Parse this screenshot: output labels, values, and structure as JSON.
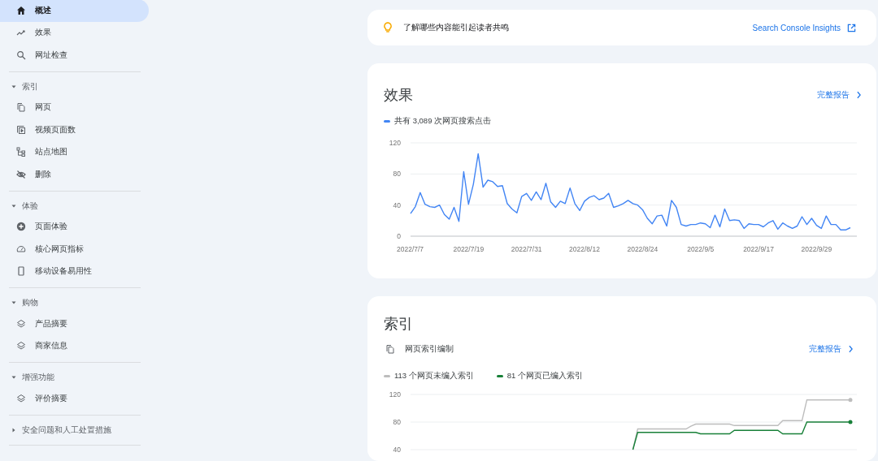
{
  "sidebar": {
    "items": [
      {
        "label": "概述",
        "selected": true
      },
      {
        "label": "效果",
        "selected": false
      },
      {
        "label": "网址检查",
        "selected": false
      }
    ],
    "groups": [
      {
        "title": "索引",
        "expanded": true,
        "items": [
          {
            "label": "网页",
            "selected": false
          },
          {
            "label": "视频页面数",
            "selected": false
          },
          {
            "label": "站点地图",
            "selected": false
          },
          {
            "label": "删除",
            "selected": false
          }
        ]
      },
      {
        "title": "体验",
        "expanded": true,
        "items": [
          {
            "label": "页面体验",
            "selected": false
          },
          {
            "label": "核心网页指标",
            "selected": false
          },
          {
            "label": "移动设备易用性",
            "selected": false
          }
        ]
      },
      {
        "title": "购物",
        "expanded": true,
        "items": [
          {
            "label": "产品摘要",
            "selected": false
          },
          {
            "label": "商家信息",
            "selected": false
          }
        ]
      },
      {
        "title": "增强功能",
        "expanded": true,
        "items": [
          {
            "label": "评价摘要",
            "selected": false
          }
        ]
      },
      {
        "title": "安全问题和人工处置措施",
        "expanded": false
      }
    ]
  },
  "insight": {
    "text": "了解哪些内容能引起读者共鸣",
    "link": "Search Console Insights"
  },
  "performance": {
    "title": "效果",
    "link": "完整报告",
    "chart_data": {
      "type": "line",
      "ylim": [
        0,
        120
      ],
      "yticks": [
        0,
        40,
        80,
        120
      ],
      "categories": [
        "2022/7/7",
        null,
        null,
        null,
        null,
        null,
        null,
        null,
        null,
        null,
        null,
        null,
        "2022/7/19",
        null,
        null,
        null,
        null,
        null,
        null,
        null,
        null,
        null,
        null,
        null,
        "2022/7/31",
        null,
        null,
        null,
        null,
        null,
        null,
        null,
        null,
        null,
        null,
        null,
        "2022/8/12",
        null,
        null,
        null,
        null,
        null,
        null,
        null,
        null,
        null,
        null,
        null,
        "2022/8/24",
        null,
        null,
        null,
        null,
        null,
        null,
        null,
        null,
        null,
        null,
        null,
        "2022/9/5",
        null,
        null,
        null,
        null,
        null,
        null,
        null,
        null,
        null,
        null,
        null,
        "2022/9/17",
        null,
        null,
        null,
        null,
        null,
        null,
        null,
        null,
        null,
        null,
        null,
        "2022/9/29",
        null,
        null,
        null,
        null,
        null,
        null,
        null
      ],
      "series": [
        {
          "name": "共有 3,089 次网页搜索点击",
          "color": "#4285f4",
          "values": [
            29,
            38,
            56,
            41,
            38,
            37,
            40,
            28,
            22,
            37,
            19,
            83,
            41,
            67,
            106,
            63,
            72,
            70,
            64,
            65,
            42,
            35,
            30,
            51,
            55,
            46,
            57,
            47,
            68,
            44,
            37,
            45,
            42,
            62,
            42,
            33,
            45,
            50,
            52,
            47,
            49,
            55,
            37,
            39,
            42,
            46,
            42,
            40,
            34,
            23,
            16,
            26,
            27,
            13,
            46,
            37,
            15,
            13,
            15,
            15,
            17,
            16,
            11,
            27,
            12,
            35,
            20,
            21,
            20,
            10,
            16,
            15,
            15,
            12,
            17,
            20,
            9,
            17,
            13,
            10,
            13,
            25,
            15,
            23,
            14,
            10,
            26,
            15,
            15,
            8,
            8,
            11
          ]
        }
      ]
    }
  },
  "index": {
    "title": "索引",
    "subtitle": "网页索引编制",
    "link": "完整报告",
    "chart_data": {
      "type": "line",
      "ylim": [
        40,
        120
      ],
      "yticks": [
        40,
        80,
        120
      ],
      "series": [
        {
          "name": "113 个网页未编入索引",
          "color": "#bdbdbd",
          "values": [
            null,
            null,
            null,
            null,
            null,
            null,
            null,
            null,
            null,
            null,
            null,
            null,
            null,
            null,
            null,
            null,
            null,
            null,
            null,
            null,
            null,
            null,
            null,
            null,
            null,
            null,
            null,
            null,
            null,
            null,
            null,
            null,
            null,
            null,
            null,
            null,
            null,
            null,
            null,
            null,
            null,
            null,
            null,
            null,
            null,
            null,
            40,
            70,
            70,
            70,
            70,
            70,
            70,
            70,
            70,
            70,
            70,
            70,
            74,
            77,
            77,
            77,
            77,
            77,
            77,
            77,
            77,
            75,
            75,
            75,
            75,
            75,
            75,
            75,
            75,
            75,
            75,
            82,
            82,
            82,
            82,
            82,
            112,
            112,
            112,
            112,
            112,
            112,
            112,
            112,
            112,
            112
          ]
        },
        {
          "name": "81 个网页已编入索引",
          "color": "#188038",
          "values": [
            null,
            null,
            null,
            null,
            null,
            null,
            null,
            null,
            null,
            null,
            null,
            null,
            null,
            null,
            null,
            null,
            null,
            null,
            null,
            null,
            null,
            null,
            null,
            null,
            null,
            null,
            null,
            null,
            null,
            null,
            null,
            null,
            null,
            null,
            null,
            null,
            null,
            null,
            null,
            null,
            null,
            null,
            null,
            null,
            null,
            null,
            40,
            65,
            65,
            65,
            65,
            65,
            65,
            65,
            65,
            65,
            65,
            65,
            65,
            65,
            63,
            63,
            63,
            63,
            63,
            63,
            63,
            68,
            68,
            68,
            68,
            68,
            68,
            68,
            68,
            68,
            68,
            63,
            63,
            63,
            63,
            63,
            80,
            80,
            80,
            80,
            80,
            80,
            80,
            80,
            80,
            80
          ]
        }
      ]
    }
  }
}
